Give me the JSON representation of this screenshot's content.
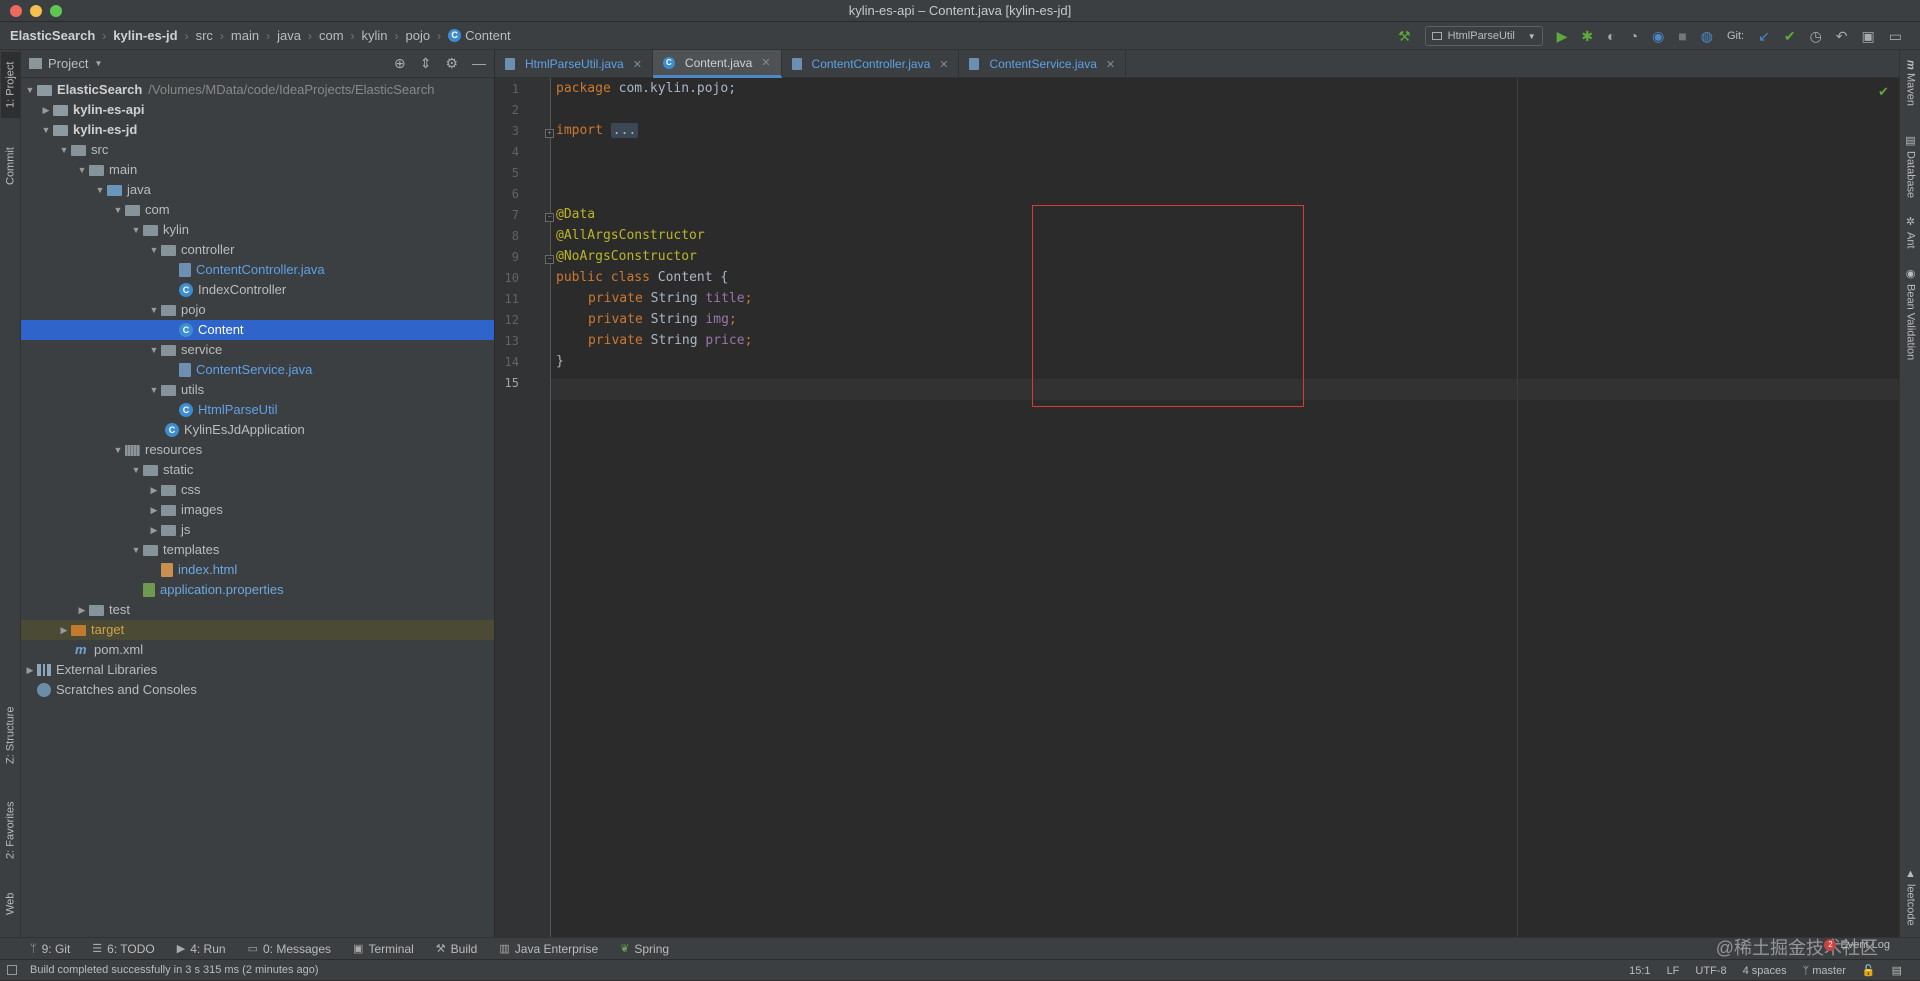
{
  "window": {
    "title": "kylin-es-api – Content.java [kylin-es-jd]"
  },
  "breadcrumbs": [
    "ElasticSearch",
    "kylin-es-jd",
    "src",
    "main",
    "java",
    "com",
    "kylin",
    "pojo",
    "Content"
  ],
  "toolbar": {
    "run_config": "HtmlParseUtil",
    "git_label": "Git:"
  },
  "left_tabs": [
    "1: Project",
    "Commit",
    "Z: Structure",
    "2: Favorites",
    "Web"
  ],
  "right_tabs": [
    "Maven",
    "Database",
    "Ant",
    "Bean Validation",
    "leetcode"
  ],
  "project_panel": {
    "title": "Project"
  },
  "tree": [
    {
      "label": "ElasticSearch",
      "path": "/Volumes/MData/code/IdeaProjects/ElasticSearch"
    },
    {
      "label": "kylin-es-api"
    },
    {
      "label": "kylin-es-jd"
    },
    {
      "label": "src"
    },
    {
      "label": "main"
    },
    {
      "label": "java"
    },
    {
      "label": "com"
    },
    {
      "label": "kylin"
    },
    {
      "label": "controller"
    },
    {
      "label": "ContentController.java"
    },
    {
      "label": "IndexController"
    },
    {
      "label": "pojo"
    },
    {
      "label": "Content"
    },
    {
      "label": "service"
    },
    {
      "label": "ContentService.java"
    },
    {
      "label": "utils"
    },
    {
      "label": "HtmlParseUtil"
    },
    {
      "label": "KylinEsJdApplication"
    },
    {
      "label": "resources"
    },
    {
      "label": "static"
    },
    {
      "label": "css"
    },
    {
      "label": "images"
    },
    {
      "label": "js"
    },
    {
      "label": "templates"
    },
    {
      "label": "index.html"
    },
    {
      "label": "application.properties"
    },
    {
      "label": "test"
    },
    {
      "label": "target"
    },
    {
      "label": "pom.xml"
    },
    {
      "label": "External Libraries"
    },
    {
      "label": "Scratches and Consoles"
    }
  ],
  "editor_tabs": [
    "HtmlParseUtil.java",
    "Content.java",
    "ContentController.java",
    "ContentService.java"
  ],
  "code": {
    "line_numbers": [
      "1",
      "2",
      "3",
      "4",
      "5",
      "6",
      "7",
      "8",
      "9",
      "10",
      "11",
      "12",
      "13",
      "14",
      "15"
    ],
    "l1": {
      "kw": "package",
      "rest": " com.kylin.pojo;"
    },
    "l3": {
      "kw": "import",
      "folded": "..."
    },
    "l7": "@Data",
    "l8": "@AllArgsConstructor",
    "l9": "@NoArgsConstructor",
    "l10": {
      "kw1": "public",
      "kw2": "class",
      "rest": " Content {"
    },
    "l11": {
      "kw": "private",
      "type": " String ",
      "field": "title",
      "end": ";"
    },
    "l12": {
      "kw": "private",
      "type": " String ",
      "field": "img",
      "end": ";"
    },
    "l13": {
      "kw": "private",
      "type": " String ",
      "field": "price",
      "end": ";"
    },
    "l14": "}"
  },
  "bottom_tools": [
    "9: Git",
    "6: TODO",
    "4: Run",
    "0: Messages",
    "Terminal",
    "Build",
    "Java Enterprise",
    "Spring"
  ],
  "event_log": {
    "label": "Event Log",
    "count": "2"
  },
  "status": {
    "message": "Build completed successfully in 3 s 315 ms (2 minutes ago)",
    "position": "15:1",
    "line_ending": "LF",
    "encoding": "UTF-8",
    "indent": "4 spaces",
    "branch": "master"
  },
  "watermark": "@稀土掘金技术社区"
}
